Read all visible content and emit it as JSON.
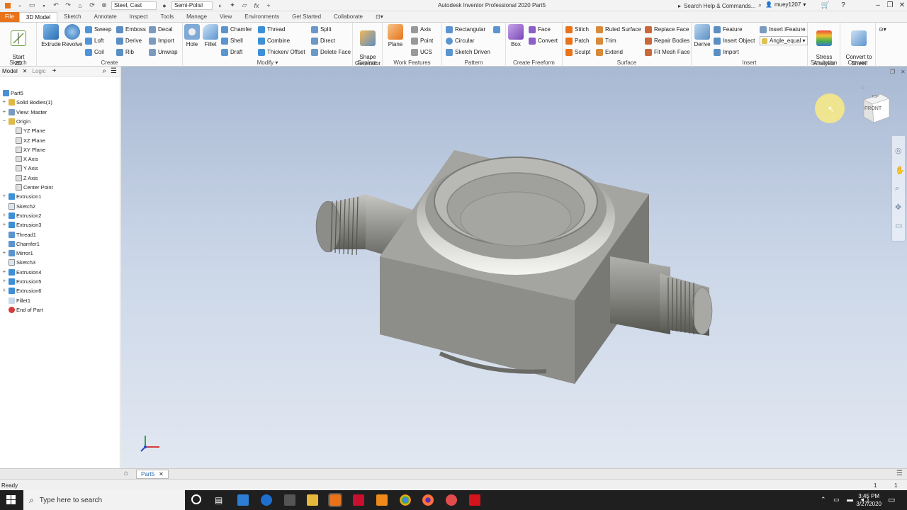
{
  "titlebar": {
    "app_title": "Autodesk Inventor Professional 2020   Part5",
    "material": "Steel, Cast",
    "appearance": "Semi-Polisl",
    "search_placeholder": "Search Help & Commands...",
    "user": "muey1207"
  },
  "tabs": [
    "File",
    "3D Model",
    "Sketch",
    "Annotate",
    "Inspect",
    "Tools",
    "Manage",
    "View",
    "Environments",
    "Get Started",
    "Collaborate"
  ],
  "active_tab": "3D Model",
  "ribbon": {
    "sketch": {
      "title": "Sketch",
      "start_sketch": "Start\n2D Sketch"
    },
    "create": {
      "title": "Create",
      "extrude": "Extrude",
      "revolve": "Revolve",
      "sweep": "Sweep",
      "loft": "Loft",
      "coil": "Coil",
      "emboss": "Emboss",
      "derive": "Derive",
      "rib": "Rib",
      "decal": "Decal",
      "import": "Import",
      "unwrap": "Unwrap"
    },
    "modify": {
      "title": "Modify",
      "hole": "Hole",
      "fillet": "Fillet",
      "chamfer": "Chamfer",
      "shell": "Shell",
      "draft": "Draft",
      "thread": "Thread",
      "combine": "Combine",
      "thicken": "Thicken/ Offset",
      "split": "Split",
      "direct": "Direct",
      "delete_face": "Delete Face"
    },
    "explore": {
      "title": "Explore",
      "shape_generator": "Shape\nGenerator"
    },
    "work_features": {
      "title": "Work Features",
      "plane": "Plane",
      "axis": "Axis",
      "point": "Point",
      "ucs": "UCS"
    },
    "pattern": {
      "title": "Pattern",
      "rectangular": "Rectangular",
      "circular": "Circular",
      "sketch_driven": "Sketch Driven"
    },
    "freeform": {
      "title": "Create Freeform",
      "box": "Box",
      "face": "Face",
      "convert": "Convert"
    },
    "surface": {
      "title": "Surface",
      "stitch": "Stitch",
      "patch": "Patch",
      "sculpt": "Sculpt",
      "ruled_surface": "Ruled Surface",
      "trim": "Trim",
      "extend": "Extend",
      "replace_face": "Replace Face",
      "repair_bodies": "Repair Bodies",
      "fit_mesh_face": "Fit Mesh Face"
    },
    "insert": {
      "title": "Insert",
      "derive": "Derive",
      "feature": "Feature",
      "insert_object": "Insert Object",
      "import": "Import",
      "insert_ifeature": "Insert iFeature",
      "angle_combo": "Angle_equal"
    },
    "simulation": {
      "title": "Simulation",
      "stress_analysis": "Stress\nAnalysis"
    },
    "convert": {
      "title": "Convert",
      "convert_sheet_metal": "Convert to\nSheet Metal"
    }
  },
  "browser": {
    "tab_model": "Model",
    "tab_logic": "Logic",
    "items": [
      {
        "label": "Part5",
        "icon": "part-icon",
        "indent": 0
      },
      {
        "label": "Solid Bodies(1)",
        "icon": "folder-icon",
        "indent": 1
      },
      {
        "label": "View: Master",
        "icon": "view-icon",
        "indent": 1
      },
      {
        "label": "Origin",
        "icon": "folder-icon",
        "indent": 1
      },
      {
        "label": "YZ Plane",
        "icon": "plane-icon",
        "indent": 2
      },
      {
        "label": "XZ Plane",
        "icon": "plane-icon",
        "indent": 2
      },
      {
        "label": "XY Plane",
        "icon": "plane-icon",
        "indent": 2
      },
      {
        "label": "X Axis",
        "icon": "axis-icon",
        "indent": 2
      },
      {
        "label": "Y Axis",
        "icon": "axis-icon",
        "indent": 2
      },
      {
        "label": "Z Axis",
        "icon": "axis-icon",
        "indent": 2
      },
      {
        "label": "Center Point",
        "icon": "point-icon",
        "indent": 2
      },
      {
        "label": "Extrusion1",
        "icon": "extrude-icon",
        "indent": 1
      },
      {
        "label": "Sketch2",
        "icon": "sketch-icon",
        "indent": 1
      },
      {
        "label": "Extrusion2",
        "icon": "extrude-icon",
        "indent": 1
      },
      {
        "label": "Extrusion3",
        "icon": "extrude-icon",
        "indent": 1
      },
      {
        "label": "Thread1",
        "icon": "thread-icon",
        "indent": 1
      },
      {
        "label": "Chamfer1",
        "icon": "chamfer-icon",
        "indent": 1
      },
      {
        "label": "Mirror1",
        "icon": "mirror-icon",
        "indent": 1
      },
      {
        "label": "Sketch3",
        "icon": "sketch-icon",
        "indent": 1
      },
      {
        "label": "Extrusion4",
        "icon": "extrude-icon",
        "indent": 1
      },
      {
        "label": "Extrusion5",
        "icon": "extrude-icon",
        "indent": 1
      },
      {
        "label": "Extrusion6",
        "icon": "extrude-icon",
        "indent": 1
      },
      {
        "label": "Fillet1",
        "icon": "fillet-icon",
        "indent": 1
      },
      {
        "label": "End of Part",
        "icon": "end-of-part-icon",
        "indent": 1
      }
    ]
  },
  "viewcube": {
    "front": "FRONT",
    "top": "TOP"
  },
  "doctab": {
    "label": "Part5"
  },
  "status": {
    "text": "Ready",
    "page": "1",
    "count": "1"
  },
  "taskbar": {
    "search_placeholder": "Type here to search",
    "time": "3:45 PM",
    "date": "3/27/2020"
  },
  "colors": {
    "accent": "#e8731a",
    "feature_blue": "#3d8fd6",
    "viewport_top": "#a9b9d3",
    "viewport_bottom": "#e2e8f1"
  }
}
